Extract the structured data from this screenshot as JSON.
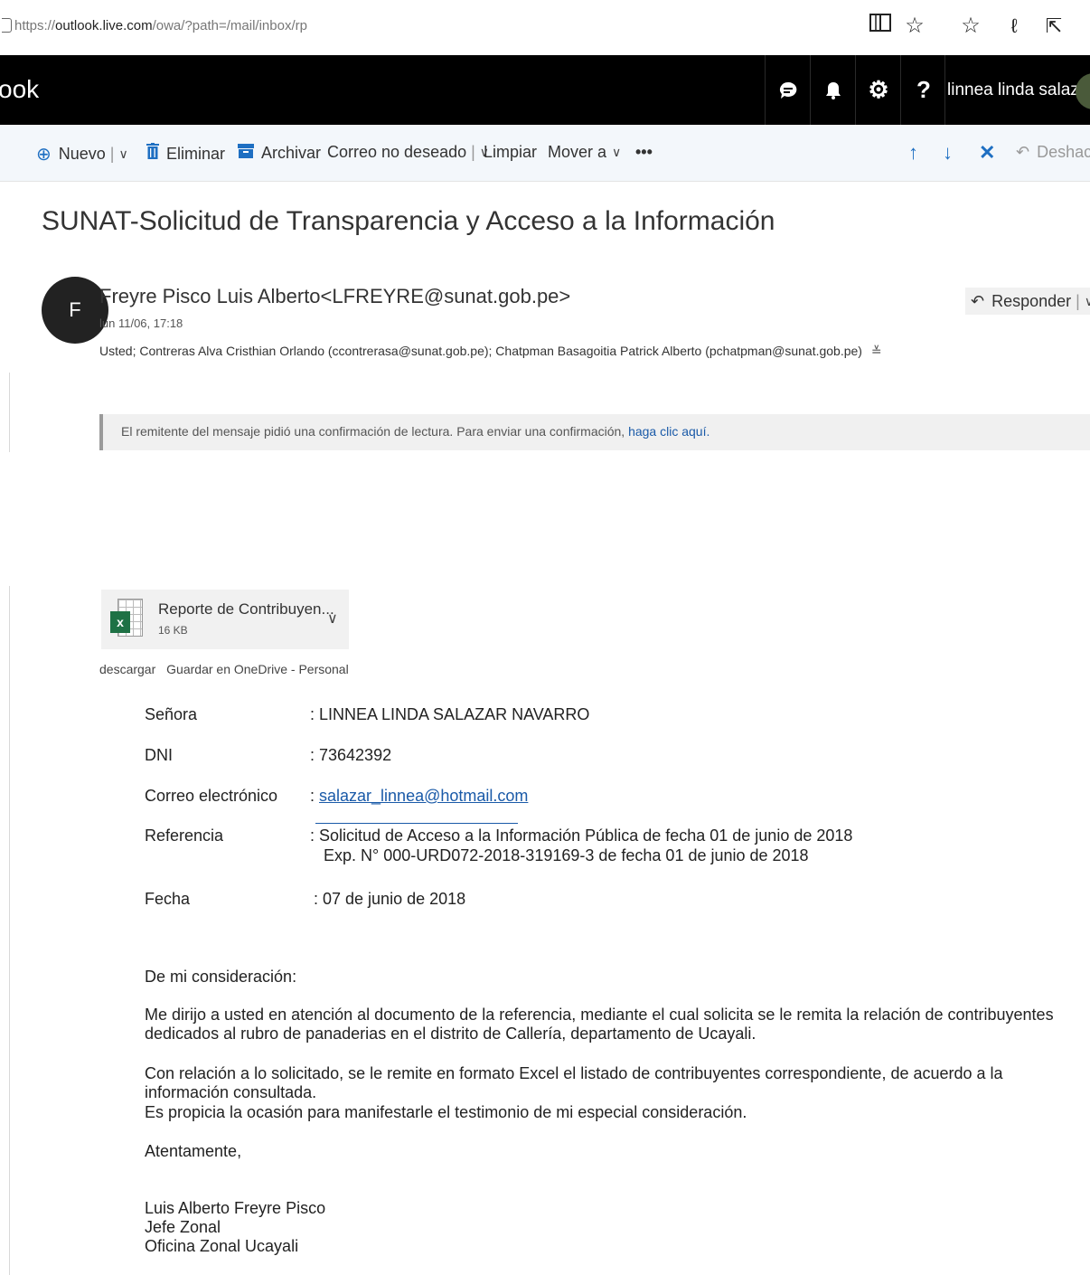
{
  "address_bar": {
    "url_prefix": "https://",
    "url_host": "outlook.live.com",
    "url_path": "/owa/?path=/mail/inbox/rp",
    "icons": [
      "reading-view-icon",
      "favorite-star-icon",
      "favorites-list-icon",
      "pen-icon",
      "share-icon"
    ]
  },
  "header": {
    "brand": "ook",
    "icons": [
      "chat-icon",
      "bell-icon",
      "gear-icon",
      "help-icon"
    ],
    "user_name": "linnea linda salaz..."
  },
  "toolbar": {
    "new_label": "Nuevo",
    "delete_label": "Eliminar",
    "archive_label": "Archivar",
    "junk_label": "Correo no deseado",
    "sweep_label": "Limpiar",
    "move_label": "Mover a",
    "more_label": "•••",
    "undo_label": "Deshacer"
  },
  "message": {
    "subject": "SUNAT-Solicitud de Transparencia y Acceso a la Información",
    "avatar_initial": "F",
    "sender": "Freyre Pisco Luis Alberto<LFREYRE@sunat.gob.pe>",
    "date": "lun 11/06, 17:18",
    "recipients": "Usted; Contreras Alva Cristhian Orlando (ccontrerasa@sunat.gob.pe); Chatpman Basagoitia Patrick Alberto (pchatpman@sunat.gob.pe)",
    "reply_label": "Responder",
    "read_receipt_text": "El remitente del mensaje pidió una confirmación de lectura. Para enviar una confirmación, ",
    "read_receipt_link": "haga clic aquí."
  },
  "attachment": {
    "name": "Reporte de Contribuyen...",
    "size": "16 KB",
    "icon": "excel-icon",
    "download_label": "descargar",
    "save_label": "Guardar en OneDrive - Personal"
  },
  "letter": {
    "fields": [
      {
        "label": "Señora",
        "value": ": LINNEA LINDA SALAZAR NAVARRO"
      },
      {
        "label": "DNI",
        "value": ": 73642392"
      },
      {
        "label": "Correo electrónico",
        "value_prefix": ": ",
        "value": "salazar_linnea@hotmail.com"
      },
      {
        "label": "Referencia",
        "value": ": Solicitud de Acceso a la Información Pública de fecha 01 de junio de 2018",
        "value_line2": "Exp. N° 000-URD072-2018-319169-3 de fecha 01 de junio de 2018"
      },
      {
        "label": "Fecha",
        "value": ": 07 de junio de 2018"
      }
    ],
    "greeting": "De mi consideración:",
    "paragraph1": "Me dirijo a usted en atención al documento de la referencia, mediante el cual solicita se le remita la relación de contribuyentes dedicados al rubro de panaderias en el distrito de Callería, departamento de Ucayali.",
    "paragraph2": "Con relación a lo solicitado, se le remite en formato Excel el listado de contribuyentes correspondiente, de acuerdo a la información consultada.",
    "paragraph3": "Es propicia la ocasión para manifestarle el testimonio de mi especial consideración.",
    "closing": "Atentamente,",
    "signature": [
      "Luis Alberto Freyre Pisco",
      "Jefe Zonal",
      "Oficina Zonal Ucayali"
    ]
  }
}
